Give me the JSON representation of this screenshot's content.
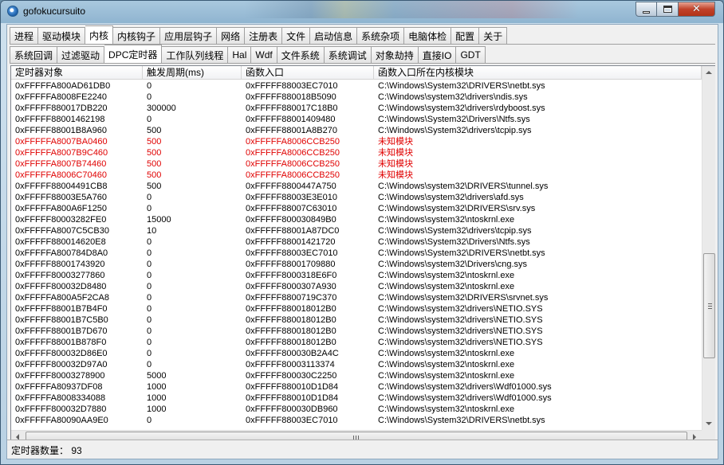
{
  "window": {
    "title": "gofokucursuito"
  },
  "tabs_main": [
    "进程",
    "驱动模块",
    "内核",
    "内核钩子",
    "应用层钩子",
    "网络",
    "注册表",
    "文件",
    "启动信息",
    "系统杂项",
    "电脑体检",
    "配置",
    "关于"
  ],
  "tabs_main_active": 2,
  "tabs_sub": [
    "系统回调",
    "过滤驱动",
    "DPC定时器",
    "工作队列线程",
    "Hal",
    "Wdf",
    "文件系统",
    "系统调试",
    "对象劫持",
    "直接IO",
    "GDT"
  ],
  "tabs_sub_active": 2,
  "columns": [
    "定时器对象",
    "触发周期(ms)",
    "函数入口",
    "函数入口所在内核模块"
  ],
  "rows": [
    [
      "0xFFFFFA800AD61DB0",
      "0",
      "0xFFFFF88003EC7010",
      "C:\\Windows\\System32\\DRIVERS\\netbt.sys"
    ],
    [
      "0xFFFFFA8008FE2240",
      "0",
      "0xFFFFF880018B5090",
      "C:\\Windows\\system32\\drivers\\ndis.sys"
    ],
    [
      "0xFFFFF880017DB220",
      "300000",
      "0xFFFFF880017C18B0",
      "C:\\Windows\\system32\\drivers\\rdyboost.sys"
    ],
    [
      "0xFFFFF88001462198",
      "0",
      "0xFFFFF88001409480",
      "C:\\Windows\\System32\\Drivers\\Ntfs.sys"
    ],
    [
      "0xFFFFF88001B8A960",
      "500",
      "0xFFFFF88001A8B270",
      "C:\\Windows\\System32\\drivers\\tcpip.sys"
    ],
    [
      "0xFFFFFA8007BA0460",
      "500",
      "0xFFFFFA8006CCB250",
      "未知模块"
    ],
    [
      "0xFFFFFA8007B9C460",
      "500",
      "0xFFFFFA8006CCB250",
      "未知模块"
    ],
    [
      "0xFFFFFA8007B74460",
      "500",
      "0xFFFFFA8006CCB250",
      "未知模块"
    ],
    [
      "0xFFFFFA8006C70460",
      "500",
      "0xFFFFFA8006CCB250",
      "未知模块"
    ],
    [
      "0xFFFFF88004491CB8",
      "500",
      "0xFFFFF8800447A750",
      "C:\\Windows\\system32\\DRIVERS\\tunnel.sys"
    ],
    [
      "0xFFFFF88003E5A760",
      "0",
      "0xFFFFF88003E3E010",
      "C:\\Windows\\system32\\drivers\\afd.sys"
    ],
    [
      "0xFFFFFA800A6F1250",
      "0",
      "0xFFFFF88007C63010",
      "C:\\Windows\\system32\\DRIVERS\\srv.sys"
    ],
    [
      "0xFFFFF80003282FE0",
      "15000",
      "0xFFFFF800030849B0",
      "C:\\Windows\\system32\\ntoskrnl.exe"
    ],
    [
      "0xFFFFFA8007C5CB30",
      "10",
      "0xFFFFF88001A87DC0",
      "C:\\Windows\\System32\\drivers\\tcpip.sys"
    ],
    [
      "0xFFFFF880014620E8",
      "0",
      "0xFFFFF88001421720",
      "C:\\Windows\\System32\\Drivers\\Ntfs.sys"
    ],
    [
      "0xFFFFFA800784D8A0",
      "0",
      "0xFFFFF88003EC7010",
      "C:\\Windows\\System32\\DRIVERS\\netbt.sys"
    ],
    [
      "0xFFFFF88001743920",
      "0",
      "0xFFFFF88001709880",
      "C:\\Windows\\system32\\Drivers\\cng.sys"
    ],
    [
      "0xFFFFF80003277860",
      "0",
      "0xFFFFF8000318E6F0",
      "C:\\Windows\\system32\\ntoskrnl.exe"
    ],
    [
      "0xFFFFF800032D8480",
      "0",
      "0xFFFFF8000307A930",
      "C:\\Windows\\system32\\ntoskrnl.exe"
    ],
    [
      "0xFFFFFA800A5F2CA8",
      "0",
      "0xFFFFF8800719C370",
      "C:\\Windows\\system32\\DRIVERS\\srvnet.sys"
    ],
    [
      "0xFFFFF88001B7B4F0",
      "0",
      "0xFFFFF880018012B0",
      "C:\\Windows\\system32\\drivers\\NETIO.SYS"
    ],
    [
      "0xFFFFF88001B7C5B0",
      "0",
      "0xFFFFF880018012B0",
      "C:\\Windows\\system32\\drivers\\NETIO.SYS"
    ],
    [
      "0xFFFFF88001B7D670",
      "0",
      "0xFFFFF880018012B0",
      "C:\\Windows\\system32\\drivers\\NETIO.SYS"
    ],
    [
      "0xFFFFF88001B878F0",
      "0",
      "0xFFFFF880018012B0",
      "C:\\Windows\\system32\\drivers\\NETIO.SYS"
    ],
    [
      "0xFFFFF800032D86E0",
      "0",
      "0xFFFFF800030B2A4C",
      "C:\\Windows\\system32\\ntoskrnl.exe"
    ],
    [
      "0xFFFFF800032D97A0",
      "0",
      "0xFFFFF80003113374",
      "C:\\Windows\\system32\\ntoskrnl.exe"
    ],
    [
      "0xFFFFF80003278900",
      "5000",
      "0xFFFFF800030C2250",
      "C:\\Windows\\system32\\ntoskrnl.exe"
    ],
    [
      "0xFFFFFA80937DF08",
      "1000",
      "0xFFFFF880010D1D84",
      "C:\\Windows\\system32\\drivers\\Wdf01000.sys"
    ],
    [
      "0xFFFFFA8008334088",
      "1000",
      "0xFFFFF880010D1D84",
      "C:\\Windows\\system32\\drivers\\Wdf01000.sys"
    ],
    [
      "0xFFFFF800032D7880",
      "1000",
      "0xFFFFF800030DB960",
      "C:\\Windows\\system32\\ntoskrnl.exe"
    ],
    [
      "0xFFFFFA80090AA9E0",
      "0",
      "0xFFFFF88003EC7010",
      "C:\\Windows\\System32\\DRIVERS\\netbt.sys"
    ]
  ],
  "red_rows": [
    5,
    6,
    7,
    8
  ],
  "status": {
    "text": "定时器数量： 93"
  },
  "colors": {
    "unknown_module": "#e00000"
  },
  "icons": {
    "app": "app-icon",
    "minimize": "minimize-icon",
    "maximize": "maximize-icon",
    "close": "close-icon"
  }
}
